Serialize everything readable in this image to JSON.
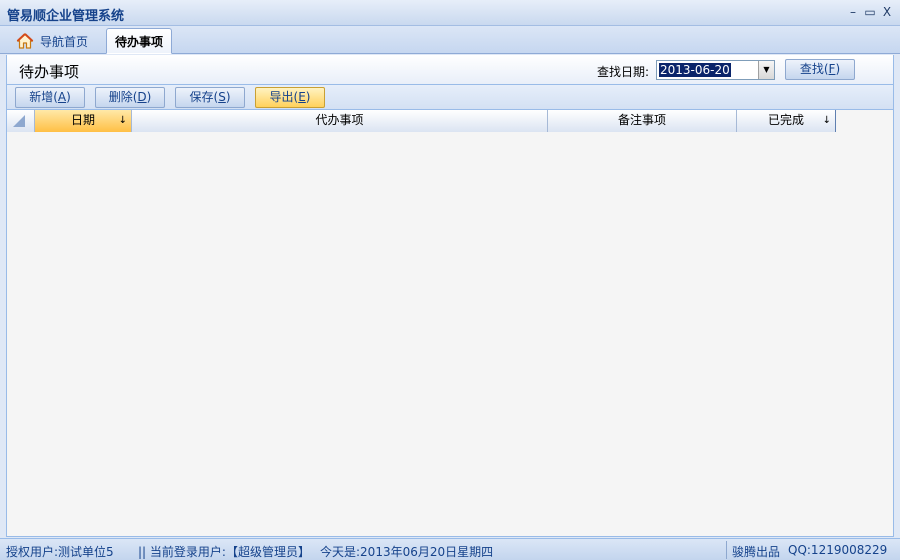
{
  "window": {
    "title": "管易顺企业管理系统",
    "controls": {
      "minimize": "–",
      "restore": "▭",
      "close": "X"
    }
  },
  "tabs": [
    {
      "label": "导航首页",
      "icon": "home-icon",
      "active": false
    },
    {
      "label": "待办事项",
      "active": true
    }
  ],
  "header": {
    "title": "待办事项",
    "search_label": "查找日期:",
    "search_date": "2013-06-20",
    "find_button": {
      "text": "查找(",
      "key": "F",
      "end": ")"
    }
  },
  "toolbar": {
    "add": {
      "text": "新增(",
      "key": "A",
      "end": ")"
    },
    "delete": {
      "text": "删除(",
      "key": "D",
      "end": ")"
    },
    "save": {
      "text": "保存(",
      "key": "S",
      "end": ")"
    },
    "export": {
      "text": "导出(",
      "key": "E",
      "end": ")"
    }
  },
  "grid": {
    "columns": [
      "日期",
      "代办事项",
      "备注事项",
      "已完成"
    ],
    "sort_indicator": "↓",
    "rows": []
  },
  "statusbar": {
    "licensed_user": "授权用户:测试单位5",
    "current_user": "|| 当前登录用户:【超级管理员】",
    "today": "今天是:2013年06月20日星期四",
    "vendor": "骏腾出品",
    "qq": "QQ:1219008229"
  },
  "colors": {
    "accent": "#15428b",
    "highlight": "#ffbf45",
    "border": "#99bbe8"
  }
}
